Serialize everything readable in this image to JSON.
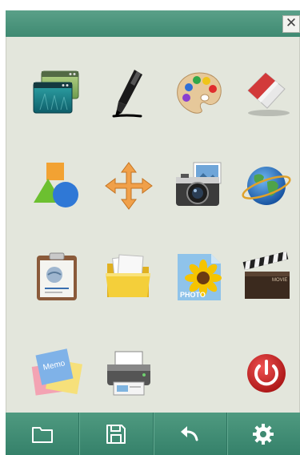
{
  "window": {
    "close_glyph": "✕"
  },
  "apps": [
    {
      "name": "window-switcher-icon"
    },
    {
      "name": "marker-pen-icon"
    },
    {
      "name": "paint-palette-icon"
    },
    {
      "name": "eraser-icon"
    },
    {
      "name": "shapes-icon"
    },
    {
      "name": "move-arrows-icon"
    },
    {
      "name": "camera-screenshot-icon"
    },
    {
      "name": "globe-browser-icon"
    },
    {
      "name": "clipboard-paste-icon"
    },
    {
      "name": "folder-open-icon"
    },
    {
      "name": "photo-sunflower-icon",
      "label": "PHOTO"
    },
    {
      "name": "clapperboard-movie-icon",
      "label": "MOVIE"
    },
    {
      "name": "memo-notes-icon",
      "label": "Memo"
    },
    {
      "name": "printer-icon"
    },
    {
      "name": "power-off-icon"
    }
  ],
  "toolbar": {
    "buttons": [
      {
        "name": "open-folder-button",
        "icon": "folder-outline-icon"
      },
      {
        "name": "save-button",
        "icon": "floppy-disk-icon"
      },
      {
        "name": "undo-button",
        "icon": "undo-arrow-icon"
      },
      {
        "name": "settings-button",
        "icon": "gear-icon"
      }
    ]
  },
  "colors": {
    "header": "#4a957c",
    "panel": "#e3e6dc",
    "footer": "#3f8a72",
    "power": "#d42a2a"
  }
}
